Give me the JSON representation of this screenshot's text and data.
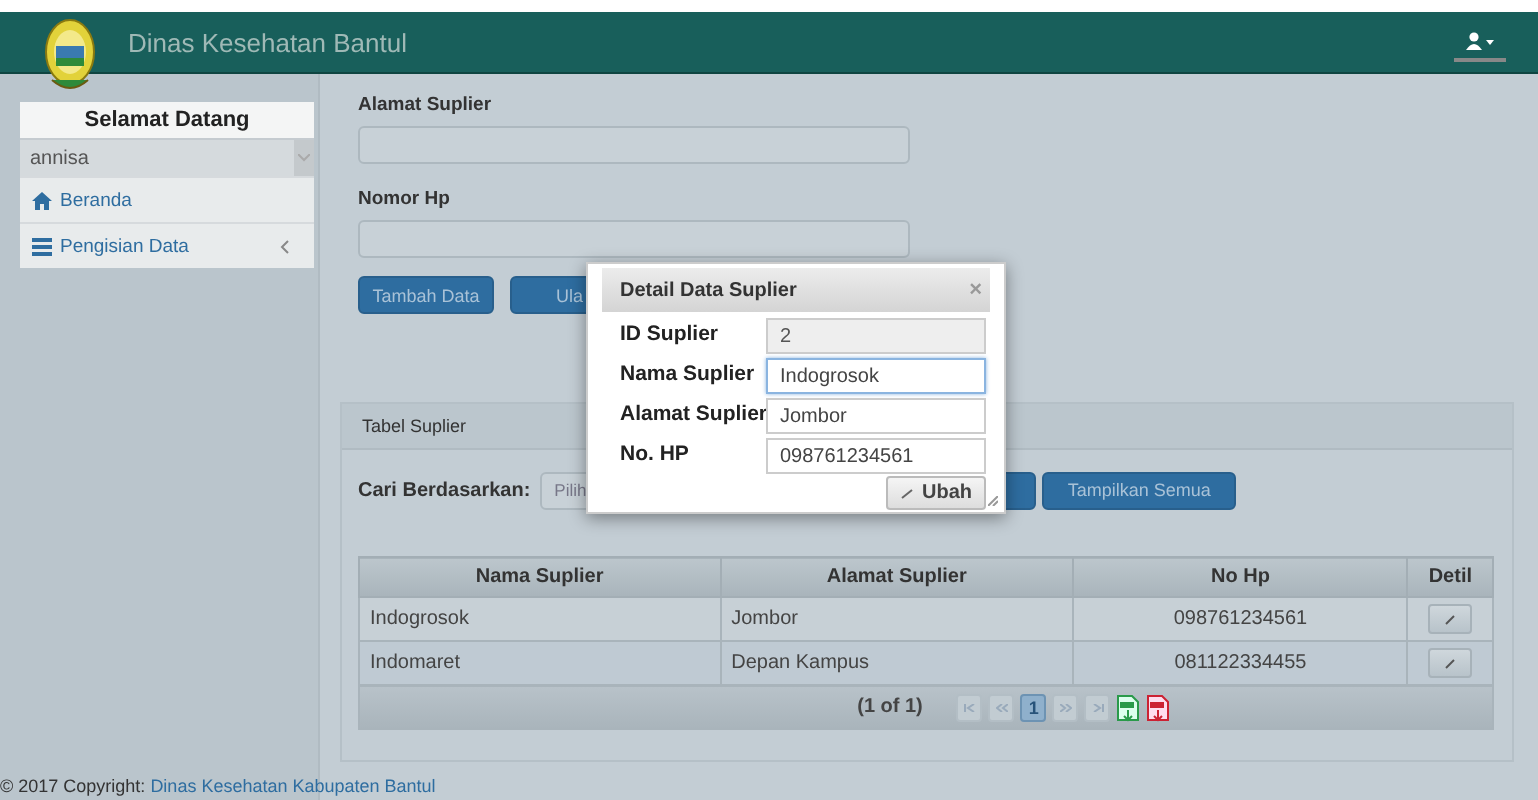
{
  "header": {
    "title": "Dinas Kesehatan Bantul"
  },
  "sidebar": {
    "welcome": "Selamat Datang",
    "user": "annisa",
    "items": [
      {
        "label": "Beranda",
        "expandable": false
      },
      {
        "label": "Pengisian Data",
        "expandable": true
      }
    ]
  },
  "form": {
    "fields": [
      {
        "label": "Alamat Suplier"
      },
      {
        "label": "Nomor Hp"
      }
    ],
    "buttons": [
      "Tambah Data",
      "Ula"
    ]
  },
  "panel": {
    "title": "Tabel Suplier",
    "search_label": "Cari Berdasarkan:",
    "select_placeholder": "Pilih",
    "show_all": "Tampilkan Semua",
    "table": {
      "columns": [
        "Nama Suplier",
        "Alamat Suplier",
        "No Hp",
        "Detil"
      ],
      "rows": [
        [
          "Indogrosok",
          "Jombor",
          "098761234561"
        ],
        [
          "Indomaret",
          "Depan Kampus",
          "081122334455"
        ]
      ],
      "page_info": "(1 of 1)",
      "pages": [
        {
          "label": "1",
          "selected": true
        }
      ]
    }
  },
  "modal": {
    "title": "Detail Data Suplier",
    "close": "×",
    "fields": [
      {
        "label": "ID Suplier",
        "value": "2",
        "disabled": true,
        "focused": false
      },
      {
        "label": "Nama Suplier",
        "value": "Indogrosok",
        "disabled": false,
        "focused": true
      },
      {
        "label": "Alamat Suplier",
        "value": "Jombor",
        "disabled": false,
        "focused": false
      },
      {
        "label": "No. HP",
        "value": "098761234561",
        "disabled": false,
        "focused": false
      }
    ],
    "button": "Ubah"
  },
  "footer": {
    "text": "© 2017 Copyright:",
    "link": "Dinas Kesehatan Kabupaten Bantul"
  }
}
